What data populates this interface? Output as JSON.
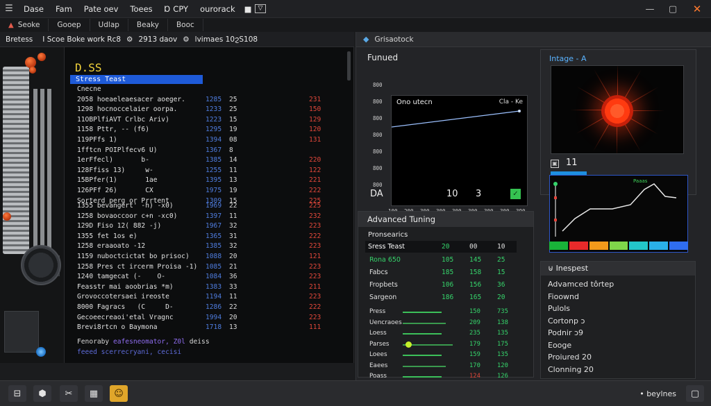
{
  "menubar": {
    "items": [
      "Dase",
      "Fam",
      "Pate oev",
      "Toees",
      "Ɒ CPY",
      "ourorack"
    ],
    "window_controls": [
      "—",
      "▢",
      "✕"
    ]
  },
  "tabs": [
    "Seoke",
    "Gooep",
    "Udlap",
    "Beaky",
    "Booc"
  ],
  "statusline": {
    "parts": [
      "Bretess",
      "I Scoe Boke work Rc8",
      "2913 daov",
      "lvimaes 10ϩS108"
    ]
  },
  "terminal": {
    "title": "D.SS",
    "selected": "Stress Teast",
    "rows_top": [
      {
        "name": "Cnecne",
        "a": "",
        "b": "",
        "c": ""
      },
      {
        "name": "2058 hoeaeleaesacer aoeger.",
        "a": "1285",
        "b": "25",
        "c": "231"
      },
      {
        "name": "1298 hocnoccelaier oorpa.",
        "a": "1233",
        "b": "25",
        "c": "150"
      },
      {
        "name": "11OBPlfiAVT Crlbc Ariv)",
        "a": "1223",
        "b": "15",
        "c": "129"
      },
      {
        "name": "1158 Pttr, -- (f6)",
        "a": "1295",
        "b": "19",
        "c": "120"
      },
      {
        "name": "119PFfs 1)",
        "a": "1394",
        "b": "08",
        "c": "131"
      },
      {
        "name": "1fftcn POIPlfecv6 U)",
        "a": "1367",
        "b": "8",
        "c": ""
      },
      {
        "name": "1erFfecl)       b-",
        "a": "1385",
        "b": "14",
        "c": "220"
      },
      {
        "name": "128Ffiss 13)     w-",
        "a": "1255",
        "b": "11",
        "c": "122"
      },
      {
        "name": "15BPfer(1)       1ae",
        "a": "1395",
        "b": "13",
        "c": "221"
      },
      {
        "name": "126PFf 26)       CX",
        "a": "1975",
        "b": "19",
        "c": "222"
      },
      {
        "name": "Sorterd perg or Prrtent",
        "a": "1309",
        "b": "15",
        "c": "225"
      }
    ],
    "rows_bottom": [
      {
        "name": "1355 bevangert' -h) -x0)",
        "a": "1969",
        "b": "22",
        "c": "225"
      },
      {
        "name": "1258 bovaoccoor c+n -xc0)",
        "a": "1397",
        "b": "11",
        "c": "232"
      },
      {
        "name": "129D Fiso 12( 882 -j)",
        "a": "1967",
        "b": "32",
        "c": "223"
      },
      {
        "name": "1355 fet 1os e)",
        "a": "1365",
        "b": "31",
        "c": "222"
      },
      {
        "name": "1258 eraaoato -12",
        "a": "1385",
        "b": "32",
        "c": "223"
      },
      {
        "name": "1159 nuboctcictat bo prisoc)",
        "a": "1088",
        "b": "20",
        "c": "121"
      },
      {
        "name": "1258 Pres ct ircerm Proisa -1)",
        "a": "1085",
        "b": "21",
        "c": "223"
      },
      {
        "name": "1240 tamgecat (-    O-",
        "a": "1084",
        "b": "36",
        "c": "223"
      },
      {
        "name": "Feasstr mai aoobrias *m)",
        "a": "1383",
        "b": "33",
        "c": "211"
      },
      {
        "name": "Grovoccotersaei ireoste",
        "a": "1194",
        "b": "11",
        "c": "223"
      },
      {
        "name": "8000 Fagracs   (C     D-",
        "a": "1286",
        "b": "22",
        "c": "222"
      },
      {
        "name": "Gecoeecreaoi'etal Vragnc",
        "a": "1994",
        "b": "20",
        "c": "223"
      },
      {
        "name": "Brevi8rtcn o Baymona",
        "a": "1718",
        "b": "13",
        "c": "111"
      }
    ],
    "footer1_white": "Fenoraby ",
    "footer1_purple": "eafesneomator, Z0l",
    "footer1_tail": " deiss",
    "footer2": "feeed scerrecryani, cecisi"
  },
  "right_panel": {
    "header": "Grisaotock",
    "graph": {
      "title": "Funued",
      "subtitle": "Ono utecn",
      "corner": "Cla - Ke",
      "y_ticks": [
        "800",
        "800",
        "800",
        "800",
        "800",
        "800",
        "800"
      ],
      "x_ticks": [
        "100",
        "200",
        "300",
        "300",
        "300",
        "300",
        "300",
        "300",
        "390"
      ],
      "footer_label": "DA",
      "footer_v1": "10",
      "footer_v2": "3"
    },
    "image": {
      "title": "Intage - A",
      "caption_num": "11"
    },
    "advanced": {
      "title": "Advanced Tuning",
      "subtitle": "Pronsearics",
      "header_row": {
        "name": "Sress Teast",
        "v1": "20",
        "v2": "00",
        "v3": "10"
      },
      "rows": [
        {
          "name": "Rona 650",
          "v1": "105",
          "v2": "145",
          "v3": "25",
          "green_name": true
        },
        {
          "name": "Fabcs",
          "v1": "185",
          "v2": "158",
          "v3": "15"
        },
        {
          "name": "Fropbets",
          "v1": "106",
          "v2": "156",
          "v3": "36"
        },
        {
          "name": "Sargeon",
          "v1": "186",
          "v2": "165",
          "v3": "20"
        }
      ],
      "slider_rows": [
        {
          "name": "Press",
          "v2": "150",
          "v3": "735",
          "dot": false
        },
        {
          "name": "Uencraoes",
          "v2": "209",
          "v3": "138",
          "dot": false
        },
        {
          "name": "Loess",
          "v2": "235",
          "v3": "135",
          "dot": false
        },
        {
          "name": "Parses",
          "v2": "179",
          "v3": "175",
          "dot": true
        },
        {
          "name": "Loees",
          "v2": "159",
          "v3": "135",
          "dot": false
        },
        {
          "name": "Eaees",
          "v2": "170",
          "v3": "120",
          "dot": false
        },
        {
          "name": "Poass",
          "v2": "124",
          "v3": "126",
          "dot": false
        }
      ]
    },
    "mini_chart": {
      "label": "Paaas",
      "swatches": [
        "#19b339",
        "#e82a2a",
        "#f39a1b",
        "#7fd64a",
        "#23c6c9",
        "#2ab0e8",
        "#2f6df0"
      ]
    },
    "inspector": {
      "title": "Inespest",
      "items": [
        "Advamced tôrtep",
        "Fioownd",
        "Pulols",
        "Cortonp ɔ",
        "Podnir ɔ9",
        "Eooge",
        "Proiured 20",
        "Clonning 20"
      ]
    }
  },
  "taskbar": {
    "label": "• beylnes"
  }
}
